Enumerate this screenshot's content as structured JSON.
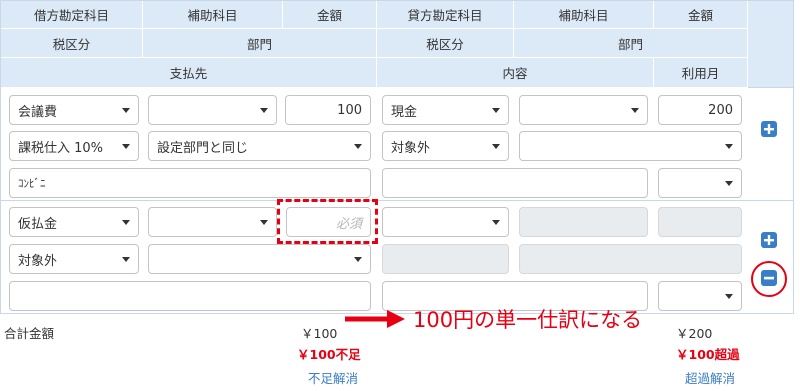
{
  "header": {
    "row1": [
      "借方勘定科目",
      "補助科目",
      "金額",
      "貸方勘定科目",
      "補助科目",
      "金額"
    ],
    "row2": [
      "税区分",
      "部門",
      "税区分",
      "部門"
    ],
    "row3": [
      "支払先",
      "内容",
      "利用月"
    ]
  },
  "entry1": {
    "debit_account": "会議費",
    "debit_sub": "",
    "debit_amount": "100",
    "credit_account": "現金",
    "credit_sub": "",
    "credit_amount": "200",
    "debit_tax": "課税仕入 10%",
    "debit_dept": "設定部門と同じ",
    "credit_tax": "対象外",
    "credit_dept": "",
    "payee": "ｺﾝﾋﾞﾆ",
    "content": "",
    "month": ""
  },
  "entry2": {
    "debit_account": "仮払金",
    "debit_sub": "",
    "debit_amount_placeholder": "必須",
    "credit_account": "",
    "debit_tax": "対象外",
    "debit_dept": "",
    "payee": "",
    "content": "",
    "month": ""
  },
  "footer": {
    "total_label": "合計金額",
    "debit_total": "￥100",
    "debit_diff": "￥100不足",
    "debit_fix": "不足解消",
    "credit_total": "￥200",
    "credit_diff": "￥100超過",
    "credit_fix": "超過解消"
  },
  "annotation": "100円の単一仕訳になる",
  "colors": {
    "accent": "#3a7dc9",
    "highlight": "#e60012",
    "header_bg": "#dce9f7"
  }
}
